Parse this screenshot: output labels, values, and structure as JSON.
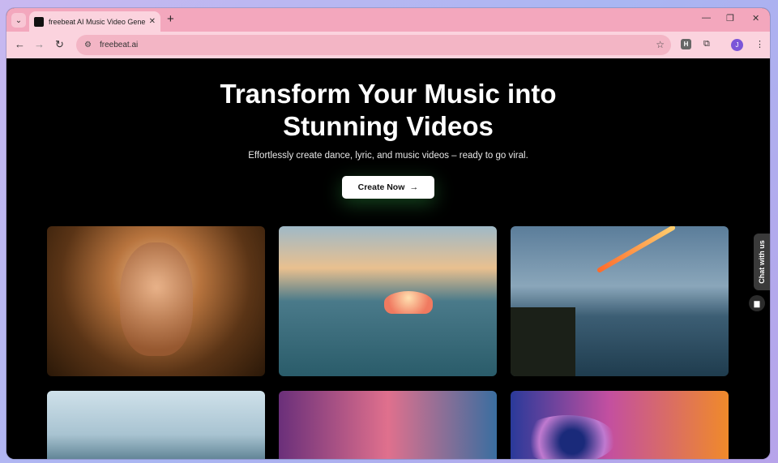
{
  "browser": {
    "tab_title": "freebeat AI Music Video Generator",
    "tab_close": "✕",
    "new_tab": "+",
    "tab_list": "⌄",
    "url": "freebeat.ai",
    "window_controls": {
      "minimize": "—",
      "restore": "❐",
      "close": "✕"
    },
    "nav": {
      "back": "←",
      "forward": "→",
      "reload": "↻"
    },
    "site_info_icon": "⚙",
    "star_icon": "☆",
    "extension_h": "H",
    "extensions_icon": "⧉",
    "profile_initial": "J",
    "menu_icon": "⋮"
  },
  "hero": {
    "title_line1": "Transform Your Music into",
    "title_line2": "Stunning Videos",
    "subtitle": "Effortlessly create dance, lyric, and music videos – ready to go viral.",
    "cta_label": "Create Now",
    "cta_arrow": "→"
  },
  "chat": {
    "tab_label": "Chat with us",
    "button_icon": "▆"
  }
}
